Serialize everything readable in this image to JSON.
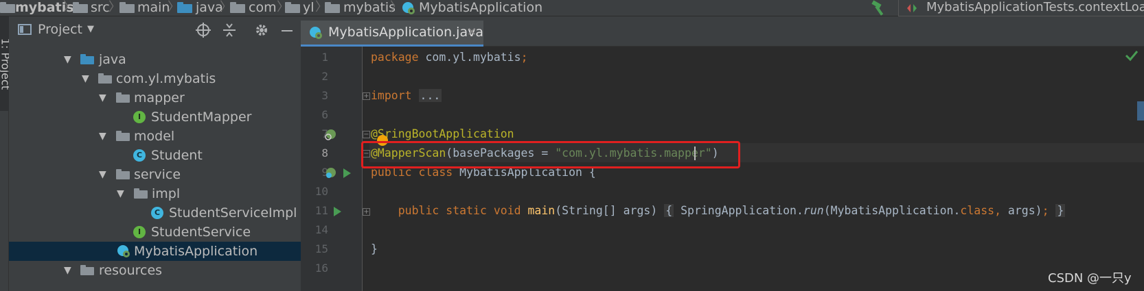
{
  "breadcrumb": {
    "items": [
      "mybatis",
      "src",
      "main",
      "java",
      "com",
      "yl",
      "mybatis",
      "MybatisApplication"
    ]
  },
  "run_config": {
    "label": "MybatisApplicationTests.contextLoa"
  },
  "left_strip": {
    "label": "1: Project"
  },
  "project_panel": {
    "title": "Project",
    "tree": [
      {
        "label": "java",
        "kind": "source-folder",
        "expanded": true
      },
      {
        "label": "com.yl.mybatis",
        "kind": "package",
        "expanded": true
      },
      {
        "label": "mapper",
        "kind": "package",
        "expanded": true
      },
      {
        "label": "StudentMapper",
        "kind": "interface"
      },
      {
        "label": "model",
        "kind": "package",
        "expanded": true
      },
      {
        "label": "Student",
        "kind": "class"
      },
      {
        "label": "service",
        "kind": "package",
        "expanded": true
      },
      {
        "label": "impl",
        "kind": "package",
        "expanded": true
      },
      {
        "label": "StudentServiceImpl",
        "kind": "class"
      },
      {
        "label": "StudentService",
        "kind": "interface"
      },
      {
        "label": "MybatisApplication",
        "kind": "spring-app",
        "selected": true
      },
      {
        "label": "resources",
        "kind": "folder",
        "expanded": true
      }
    ]
  },
  "editor": {
    "tab": {
      "label": "MybatisApplication.java"
    },
    "line_numbers": [
      "1",
      "2",
      "3",
      "6",
      "7",
      "8",
      "9",
      "10",
      "11",
      "14",
      "15",
      "16"
    ],
    "code": {
      "l1_kw": "package",
      "l1_rest": " com.yl.mybatis",
      "l1_semi": ";",
      "l3_kw": "import",
      "l3_folded": "...",
      "l7_at": "@S",
      "l7_rest": "ringBootApplication",
      "l8_anno": "@MapperScan",
      "l8_mid": "(basePackages = ",
      "l8_str": "\"com.yl.mybatis.mapper\"",
      "l8_end": ")",
      "l9_kw": "public class",
      "l9_rest": " MybatisApplication {",
      "l11_kw": "public static void",
      "l11_fn": "main",
      "l11_args": "(String[] args)",
      "l11_open": "{",
      "l11_call": " SpringApplication.",
      "l11_run": "run",
      "l11_params": "(MybatisApplication.",
      "l11_class": "class",
      "l11_comma": ",",
      "l11_tail": " args)",
      "l11_semi": ";",
      "l11_close": "}",
      "l15": "}"
    }
  },
  "watermark": "CSDN @一只y",
  "colors": {
    "highlight_box": "#e11f1f",
    "selection": "#0d293e",
    "tab_underline": "#4a88c7"
  }
}
